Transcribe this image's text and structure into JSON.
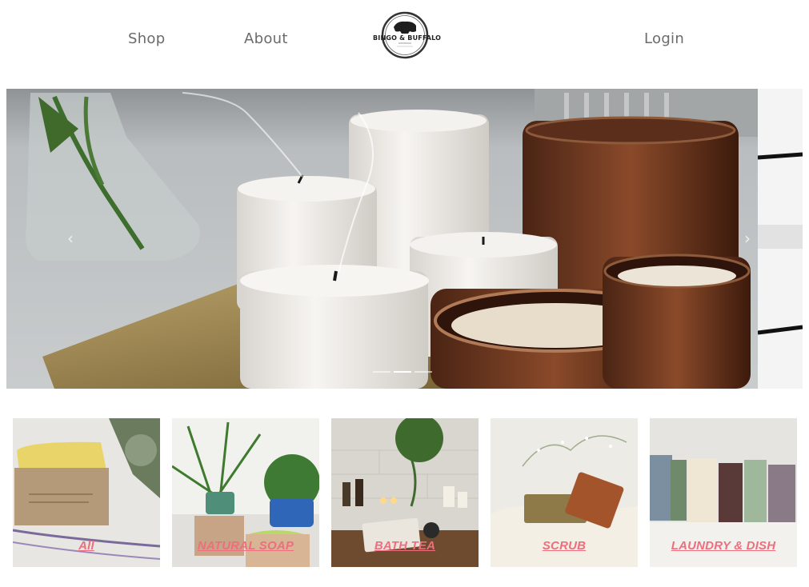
{
  "nav": {
    "shop_label": "Shop",
    "about_label": "About",
    "login_label": "Login",
    "logo_text": "BINGO & BUFFALO"
  },
  "hero": {
    "prev_icon": "chevron-left-icon",
    "next_icon": "chevron-right-icon",
    "prev_glyph": "‹",
    "next_glyph": "›",
    "slide_count": 3,
    "active_slide": 1
  },
  "categories": [
    {
      "label": "All"
    },
    {
      "label": "NATURAL SOAP"
    },
    {
      "label": "BATH TEA"
    },
    {
      "label": "SCRUB"
    },
    {
      "label": "LAUNDRY & DISH"
    }
  ],
  "colors": {
    "nav_text": "#6b6b6b",
    "category_label": "#ee6e7d"
  }
}
